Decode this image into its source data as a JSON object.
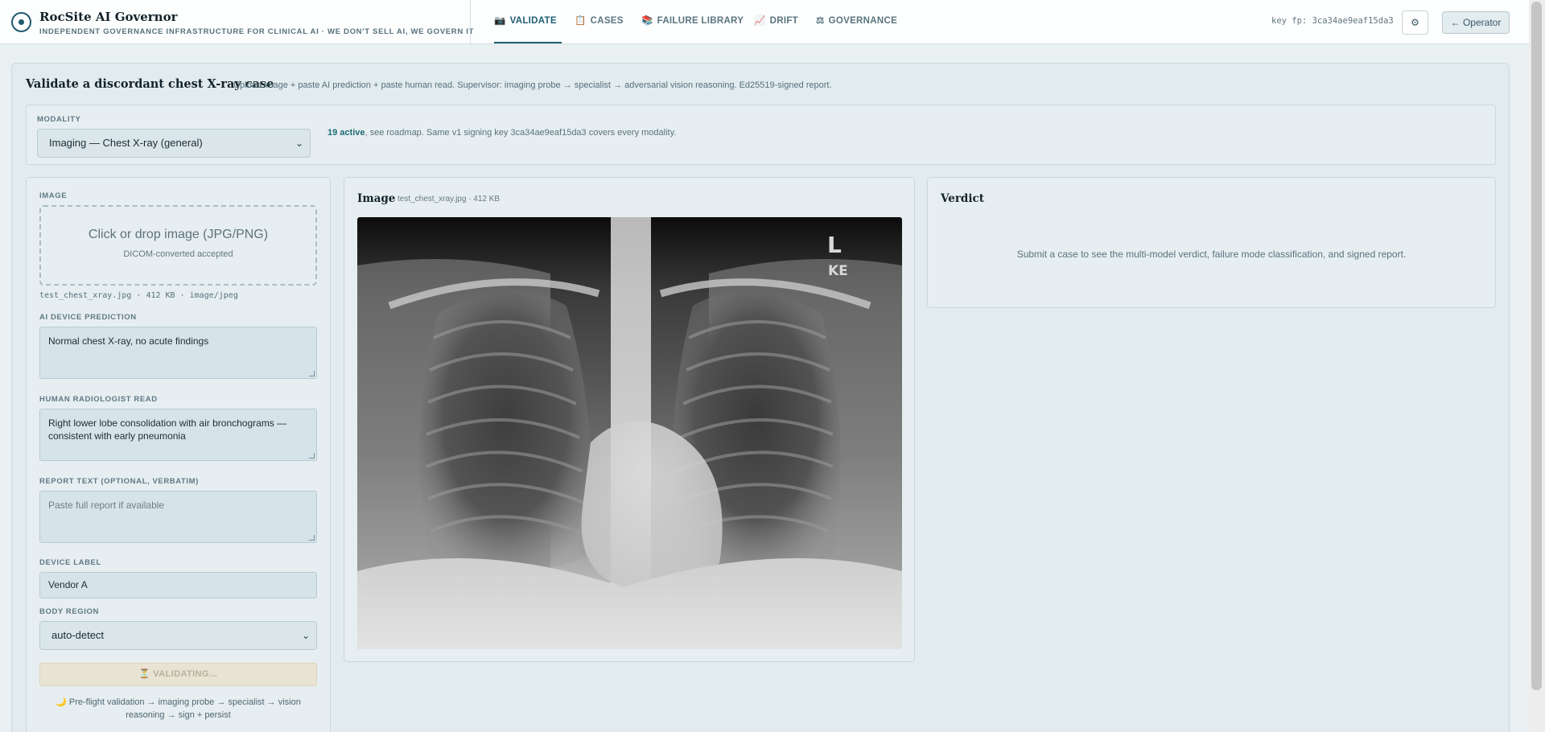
{
  "app": {
    "title": "RocSite AI Governor",
    "subtitle": "INDEPENDENT GOVERNANCE INFRASTRUCTURE FOR CLINICAL AI · WE DON'T SELL AI, WE GOVERN IT"
  },
  "nav": {
    "tabs": [
      {
        "icon": "📷",
        "label": "VALIDATE"
      },
      {
        "icon": "📋",
        "label": "CASES"
      },
      {
        "icon": "📚",
        "label": "FAILURE LIBRARY"
      },
      {
        "icon": "📈",
        "label": "DRIFT"
      },
      {
        "icon": "⚖",
        "label": "GOVERNANCE"
      }
    ]
  },
  "header": {
    "key_fp": "key fp: 3ca34ae9eaf15da3",
    "gear_icon": "⚙",
    "operator_label": "← Operator"
  },
  "main": {
    "title": "Validate a discordant chest X-ray case",
    "description": "Upload image + paste AI prediction + paste human read. Supervisor: imaging probe → specialist → adversarial vision reasoning. Ed25519-signed report."
  },
  "modality": {
    "label": "MODALITY",
    "selected": "Imaging — Chest X-ray (general)",
    "active_count": "19 active",
    "note": ", see roadmap. Same v1 signing key 3ca34ae9eaf15da3 covers every modality."
  },
  "form": {
    "image_label": "IMAGE",
    "dropzone_main": "Click or drop image (JPG/PNG)",
    "dropzone_sub": "DICOM-converted accepted",
    "file_meta": "test_chest_xray.jpg · 412 KB · image/jpeg",
    "ai_prediction_label": "AI DEVICE PREDICTION",
    "ai_prediction_value": "Normal chest X-ray, no acute findings",
    "human_read_label": "HUMAN RADIOLOGIST READ",
    "human_read_value": "Right lower lobe consolidation with air bronchograms — consistent with early pneumonia",
    "report_label": "REPORT TEXT (OPTIONAL, VERBATIM)",
    "report_placeholder": "Paste full report if available",
    "device_label_label": "DEVICE LABEL",
    "device_label_value": "Vendor A",
    "body_region_label": "BODY REGION",
    "body_region_value": "auto-detect",
    "validate_button": "⏳ VALIDATING...",
    "preflight_text": "🌙 Pre-flight validation → imaging probe → specialist → vision reasoning → sign + persist"
  },
  "image_panel": {
    "title": "Image",
    "meta": "test_chest_xray.jpg · 412 KB",
    "marker_l": "L",
    "marker_ke": "KE"
  },
  "verdict": {
    "title": "Verdict",
    "message": "Submit a case to see the multi-model verdict, failure mode classification, and signed report."
  }
}
